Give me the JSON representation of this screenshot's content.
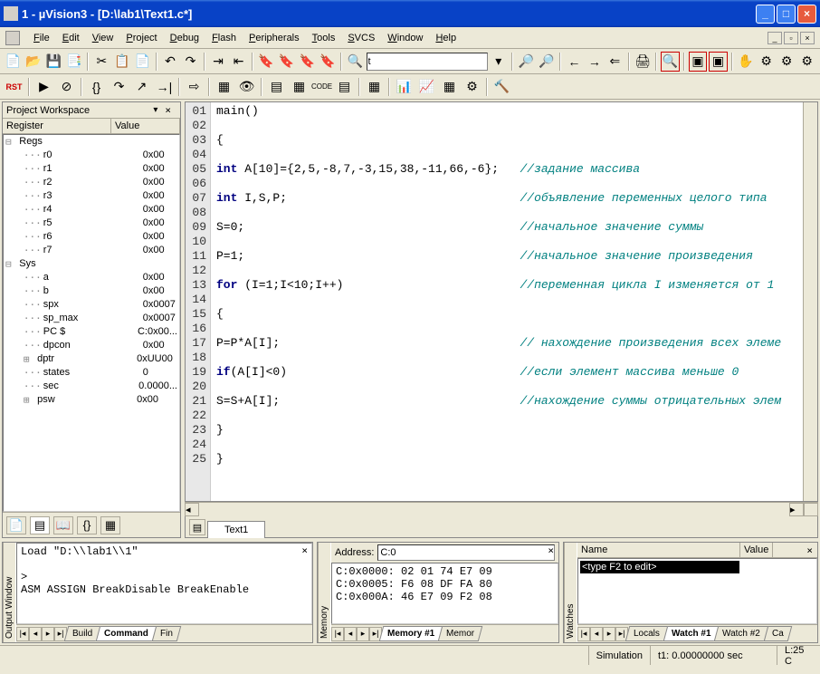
{
  "window": {
    "title": "1  - µVision3 - [D:\\lab1\\Text1.c*]"
  },
  "menu": {
    "items": [
      "File",
      "Edit",
      "View",
      "Project",
      "Debug",
      "Flash",
      "Peripherals",
      "Tools",
      "SVCS",
      "Window",
      "Help"
    ]
  },
  "toolbar": {
    "combo_value": "t"
  },
  "workspace": {
    "title": "Project Workspace",
    "col_register": "Register",
    "col_value": "Value",
    "groups": [
      {
        "name": "Regs",
        "items": [
          {
            "name": "r0",
            "value": "0x00"
          },
          {
            "name": "r1",
            "value": "0x00"
          },
          {
            "name": "r2",
            "value": "0x00"
          },
          {
            "name": "r3",
            "value": "0x00"
          },
          {
            "name": "r4",
            "value": "0x00"
          },
          {
            "name": "r5",
            "value": "0x00"
          },
          {
            "name": "r6",
            "value": "0x00"
          },
          {
            "name": "r7",
            "value": "0x00"
          }
        ]
      },
      {
        "name": "Sys",
        "items": [
          {
            "name": "a",
            "value": "0x00"
          },
          {
            "name": "b",
            "value": "0x00"
          },
          {
            "name": "spx",
            "value": "0x0007"
          },
          {
            "name": "sp_max",
            "value": "0x0007"
          },
          {
            "name": "PC $",
            "value": "C:0x00..."
          },
          {
            "name": "dpcon",
            "value": "0x00"
          },
          {
            "name": "dptr",
            "value": "0xUU00",
            "exp": true
          },
          {
            "name": "states",
            "value": "0"
          },
          {
            "name": "sec",
            "value": "0.0000..."
          },
          {
            "name": "psw",
            "value": "0x00",
            "exp": true
          }
        ]
      }
    ]
  },
  "editor": {
    "tab": "Text1",
    "lines": [
      {
        "n": "01",
        "code": "main()"
      },
      {
        "n": "02",
        "code": ""
      },
      {
        "n": "03",
        "code": "{"
      },
      {
        "n": "04",
        "code": ""
      },
      {
        "n": "05",
        "kw": "int",
        "rest": " A[10]={2,5,-8,7,-3,15,38,-11,66,-6};",
        "cm": "//задание массива"
      },
      {
        "n": "06",
        "code": ""
      },
      {
        "n": "07",
        "kw": "int",
        "rest": " I,S,P;",
        "cm": "//объявление переменных целого типа"
      },
      {
        "n": "08",
        "code": ""
      },
      {
        "n": "09",
        "code": "S=0;",
        "cm": "//начальное значение суммы"
      },
      {
        "n": "10",
        "code": ""
      },
      {
        "n": "11",
        "code": "P=1;",
        "cm": "//начальное значение произведения"
      },
      {
        "n": "12",
        "code": ""
      },
      {
        "n": "13",
        "kw": "for",
        "rest": " (I=1;I<10;I++)",
        "cm": "//переменная цикла I изменяется от 1"
      },
      {
        "n": "14",
        "code": ""
      },
      {
        "n": "15",
        "code": "{"
      },
      {
        "n": "16",
        "code": ""
      },
      {
        "n": "17",
        "code": "P=P*A[I];",
        "cm": "// нахождение произведения всех элеме"
      },
      {
        "n": "18",
        "code": ""
      },
      {
        "n": "19",
        "kw": "if",
        "rest": "(A[I]<0)",
        "cm": "//если элемент массива меньше 0"
      },
      {
        "n": "20",
        "code": ""
      },
      {
        "n": "21",
        "code": "S=S+A[I];",
        "cm": "//нахождение суммы отрицательных элем"
      },
      {
        "n": "22",
        "code": ""
      },
      {
        "n": "23",
        "code": "}"
      },
      {
        "n": "24",
        "code": ""
      },
      {
        "n": "25",
        "code": "}"
      }
    ]
  },
  "output": {
    "label": "Output Window",
    "text": "Load \"D:\\\\lab1\\\\1\"\n\n>\nASM ASSIGN BreakDisable BreakEnable",
    "tabs": [
      "Build",
      "Command",
      "Fin"
    ]
  },
  "memory": {
    "label": "Memory",
    "addr_label": "Address:",
    "addr_value": "C:0",
    "text": "C:0x0000: 02 01 74 E7 09\nC:0x0005: F6 08 DF FA 80\nC:0x000A: 46 E7 09 F2 08",
    "tabs": [
      "Memory #1",
      "Memor"
    ]
  },
  "watch": {
    "label": "Watches",
    "col_name": "Name",
    "col_value": "Value",
    "hint": "<type F2 to edit>",
    "tabs": [
      "Locals",
      "Watch #1",
      "Watch #2",
      "Ca"
    ]
  },
  "status": {
    "mode": "Simulation",
    "time": "t1: 0.00000000 sec",
    "pos": "L:25 C"
  }
}
